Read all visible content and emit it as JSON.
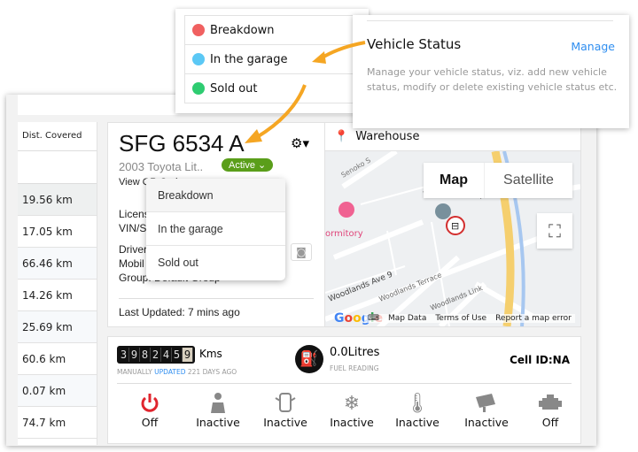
{
  "status_list": {
    "items": [
      {
        "label": "Breakdown",
        "color": "#f06060"
      },
      {
        "label": "In the garage",
        "color": "#5bc8f5"
      },
      {
        "label": "Sold out",
        "color": "#2ecc71"
      }
    ]
  },
  "vehicle_status_card": {
    "title": "Vehicle Status",
    "manage_label": "Manage",
    "description": "Manage your vehicle status, viz. add new vehicle status, modify or delete existing vehicle status etc."
  },
  "left_table": {
    "header": "Dist. Covered",
    "rows": [
      "19.56 km",
      "17.05 km",
      "66.46 km",
      "14.26 km",
      "25.69 km",
      "60.6 km",
      "0.07 km",
      "74.7 km"
    ]
  },
  "vehicle": {
    "plate": "SFG 6534 A",
    "model": "2003 Toyota Lit..",
    "status": "Active",
    "view_link": "View QR Code",
    "license_label": "Licens",
    "vin_label": "VIN/S",
    "driver_label": "Driver",
    "mobile_label": "Mobil",
    "group_label": "Group: Default Group",
    "last_updated": "Last Updated: 7 mins ago"
  },
  "status_dropdown": {
    "options": [
      "Breakdown",
      "In the garage",
      "Sold out"
    ]
  },
  "map": {
    "location": "Warehouse",
    "map_tab": "Map",
    "satellite_tab": "Satellite",
    "labels": [
      "Senoko S",
      "Woodlands Spectrum I",
      "ormitory",
      "Woodlands Ave 9",
      "Woodlands Terrace",
      "Woodlands Link"
    ],
    "footer": [
      "Map Data",
      "Terms of Use",
      "Report a map error"
    ]
  },
  "readings": {
    "odometer_digits": [
      "3",
      "9",
      "8",
      "2",
      "4",
      "5",
      "9"
    ],
    "odometer_unit": "Kms",
    "odo_note_pre": "MANUALLY",
    "odo_note_link": "UPDATED",
    "odo_note_post": "221 DAYS AGO",
    "fuel": "0.0Litres",
    "fuel_label": "FUEL READING",
    "cell_id": "Cell ID:NA"
  },
  "sensors": [
    {
      "icon": "power",
      "label": "Off"
    },
    {
      "icon": "seatbelt",
      "label": "Inactive"
    },
    {
      "icon": "car-door",
      "label": "Inactive"
    },
    {
      "icon": "snowflake",
      "label": "Inactive"
    },
    {
      "icon": "thermometer",
      "label": "Inactive"
    },
    {
      "icon": "camera",
      "label": "Inactive"
    },
    {
      "icon": "engine",
      "label": "Off"
    }
  ],
  "colors": {
    "accent": "#2f8ef0",
    "active": "#5a9e1a",
    "arrow": "#f5a623",
    "power_off": "#e0252e"
  }
}
